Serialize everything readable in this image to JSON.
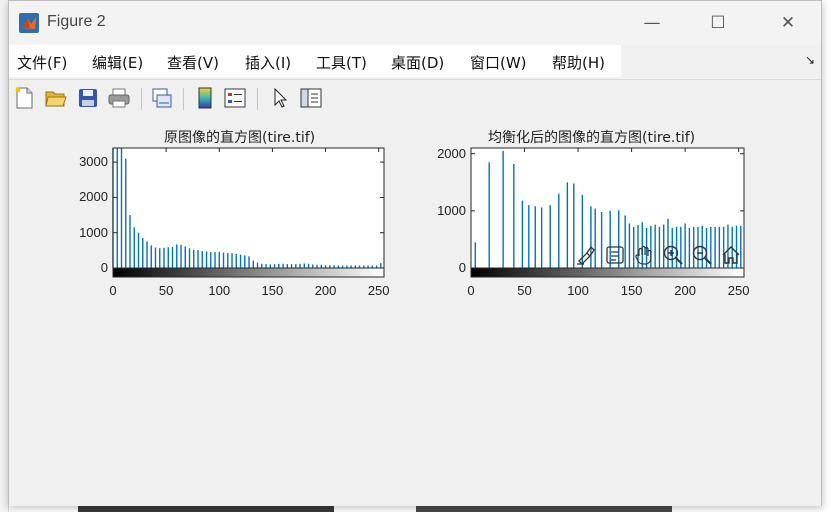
{
  "window": {
    "title": "Figure 2"
  },
  "controls": {
    "minimize": "—",
    "maximize": "☐",
    "close": "✕"
  },
  "menu": {
    "items": [
      "文件(F)",
      "编辑(E)",
      "查看(V)",
      "插入(I)",
      "工具(T)",
      "桌面(D)",
      "窗口(W)",
      "帮助(H)"
    ],
    "overflow_glyph": "↘"
  },
  "toolbar": {
    "icons": [
      "new-figure-icon",
      "open-file-icon",
      "save-icon",
      "print-icon",
      "link-plot-icon",
      "insert-colorbar-icon",
      "insert-legend-icon",
      "edit-plot-icon",
      "property-inspector-icon"
    ]
  },
  "axes_toolbar": {
    "icons": [
      "brush-icon",
      "data-tips-icon",
      "pan-icon",
      "zoom-in-icon",
      "zoom-out-icon",
      "restore-view-icon"
    ]
  },
  "colors": {
    "bar": "#0072BD",
    "axis": "#262626",
    "window_bg": "#f0f0f0"
  },
  "chart_data": [
    {
      "type": "bar",
      "title": "原图像的直方图(tire.tif)",
      "xlim": [
        0,
        255
      ],
      "ylim": [
        0,
        3400
      ],
      "xticks": [
        "0",
        "50",
        "100",
        "150",
        "200",
        "250"
      ],
      "yticks": [
        "0",
        "1000",
        "2000",
        "3000"
      ],
      "colorbar": "gray",
      "x": [
        0,
        4,
        8,
        12,
        16,
        20,
        24,
        28,
        32,
        36,
        40,
        44,
        48,
        52,
        56,
        60,
        64,
        68,
        72,
        76,
        80,
        84,
        88,
        92,
        96,
        100,
        104,
        108,
        112,
        116,
        120,
        124,
        128,
        132,
        136,
        140,
        144,
        148,
        152,
        156,
        160,
        164,
        168,
        172,
        176,
        180,
        184,
        188,
        192,
        196,
        200,
        204,
        208,
        212,
        216,
        220,
        224,
        228,
        232,
        236,
        240,
        244,
        248,
        252
      ],
      "values": [
        3400,
        3400,
        3400,
        3100,
        1500,
        1150,
        1000,
        850,
        750,
        640,
        580,
        560,
        570,
        590,
        600,
        670,
        660,
        610,
        560,
        520,
        510,
        480,
        470,
        450,
        450,
        460,
        440,
        420,
        420,
        400,
        380,
        360,
        330,
        210,
        150,
        120,
        110,
        100,
        110,
        120,
        120,
        110,
        110,
        110,
        120,
        130,
        120,
        100,
        90,
        90,
        80,
        80,
        80,
        70,
        70,
        70,
        70,
        70,
        70,
        70,
        70,
        70,
        70,
        140
      ]
    },
    {
      "type": "bar",
      "title": "均衡化后的图像的直方图(tire.tif)",
      "xlim": [
        0,
        255
      ],
      "ylim": [
        0,
        2100
      ],
      "xticks": [
        "0",
        "50",
        "100",
        "150",
        "200",
        "250"
      ],
      "yticks": [
        "0",
        "1000",
        "2000"
      ],
      "colorbar": "gray",
      "x": [
        4,
        17,
        30,
        40,
        48,
        54,
        60,
        66,
        74,
        82,
        90,
        96,
        104,
        112,
        116,
        122,
        130,
        138,
        144,
        148,
        152,
        156,
        160,
        164,
        168,
        172,
        176,
        180,
        184,
        188,
        192,
        196,
        200,
        204,
        208,
        212,
        216,
        220,
        224,
        228,
        232,
        236,
        240,
        244,
        248,
        252
      ],
      "values": [
        450,
        1850,
        2050,
        1820,
        1180,
        1100,
        1080,
        1060,
        1100,
        1300,
        1500,
        1480,
        1280,
        1080,
        1040,
        980,
        1000,
        1010,
        920,
        780,
        720,
        750,
        800,
        700,
        740,
        760,
        720,
        760,
        860,
        700,
        720,
        720,
        780,
        700,
        720,
        720,
        740,
        700,
        720,
        720,
        720,
        720,
        760,
        720,
        740,
        740
      ]
    }
  ]
}
